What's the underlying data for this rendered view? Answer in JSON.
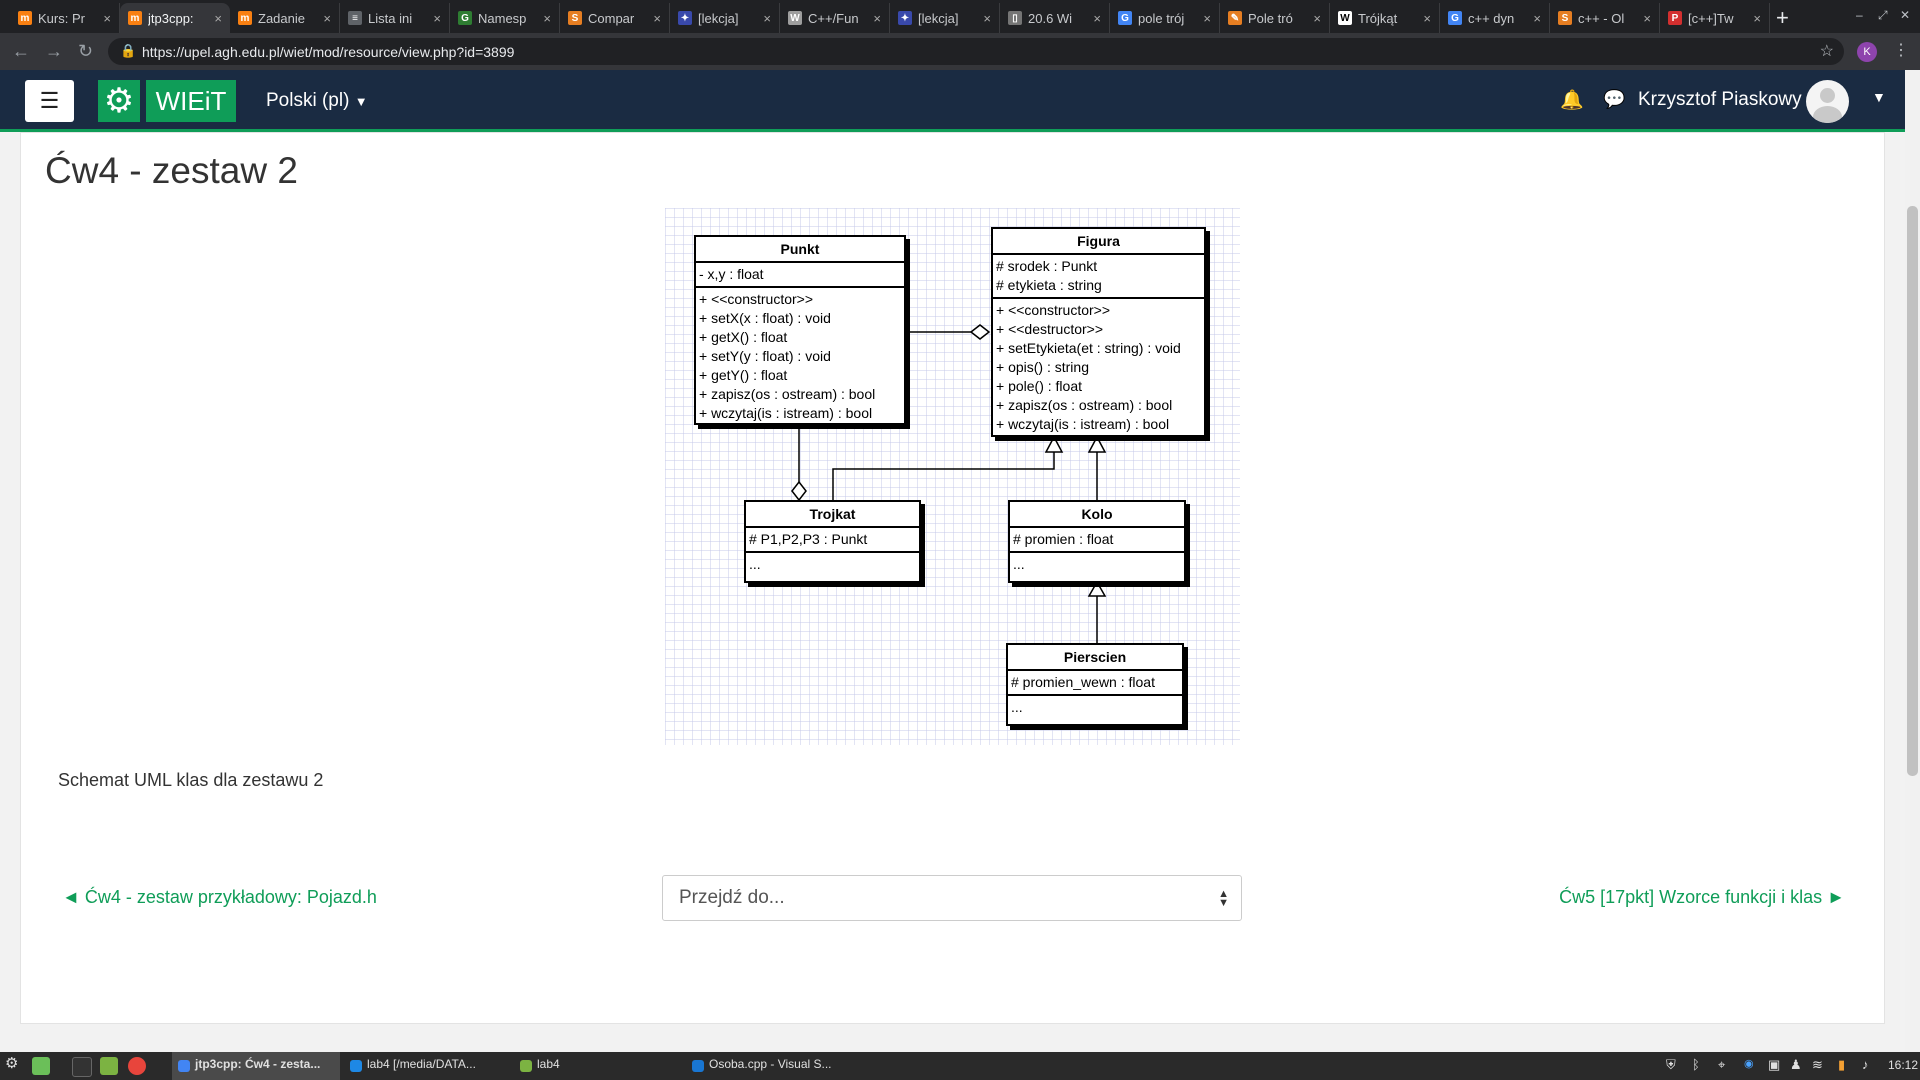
{
  "browser": {
    "tabs": [
      {
        "title": "Kurs: Pr",
        "favicon_color": "#f98012",
        "favicon": "m"
      },
      {
        "title": "jtp3cpp: ",
        "favicon_color": "#f98012",
        "favicon": "m",
        "active": true
      },
      {
        "title": "Zadanie",
        "favicon_color": "#f98012",
        "favicon": "m"
      },
      {
        "title": "Lista ini",
        "favicon_color": "#5f6368",
        "favicon": "≡"
      },
      {
        "title": "Namesp",
        "favicon_color": "#2e7d32",
        "favicon": "G"
      },
      {
        "title": "Compar",
        "favicon_color": "#e67e22",
        "favicon": "S"
      },
      {
        "title": "[lekcja]",
        "favicon_color": "#3949ab",
        "favicon": "✦"
      },
      {
        "title": "C++/Fun",
        "favicon_color": "#9e9e9e",
        "favicon": "W"
      },
      {
        "title": "[lekcja]",
        "favicon_color": "#3949ab",
        "favicon": "✦"
      },
      {
        "title": "20.6 Wi",
        "favicon_color": "#757575",
        "favicon": "▯"
      },
      {
        "title": "pole trój",
        "favicon_color": "#4285f4",
        "favicon": "G"
      },
      {
        "title": "Pole tró",
        "favicon_color": "#e67e22",
        "favicon": "✎"
      },
      {
        "title": "Trójkąt",
        "favicon_color": "#ffffff",
        "favicon": "W"
      },
      {
        "title": "c++ dyn",
        "favicon_color": "#4285f4",
        "favicon": "G"
      },
      {
        "title": "c++ - Ol",
        "favicon_color": "#e67e22",
        "favicon": "S"
      },
      {
        "title": "[c++]Tw",
        "favicon_color": "#d32f2f",
        "favicon": "P"
      }
    ],
    "close_glyph": "×",
    "new_tab": "+",
    "url": "https://upel.agh.edu.pl/wiet/mod/resource/view.php?id=3899",
    "profile_initial": "K"
  },
  "navbar": {
    "logo_text": "WIEiT",
    "language": "Polski (pl)",
    "user_name": "Krzysztof Piaskowy"
  },
  "page": {
    "title": "Ćw4 - zestaw 2",
    "caption": "Schemat UML klas dla zestawu 2",
    "prev_link": "◄ Ćw4 - zestaw przykładowy: Pojazd.h",
    "jump_placeholder": "Przejdź do...",
    "next_link": "Ćw5 [17pkt] Wzorce funkcji i klas ►"
  },
  "uml": {
    "punkt": {
      "name": "Punkt",
      "attrs": [
        "- x,y : float"
      ],
      "methods": [
        "+ <<constructor>>",
        "+ setX(x : float) : void",
        "+ getX() : float",
        "+ setY(y : float) : void",
        "+ getY() : float",
        "+ zapisz(os : ostream) : bool",
        "+ wczytaj(is : istream) : bool"
      ]
    },
    "figura": {
      "name": "Figura",
      "attrs": [
        "# srodek : Punkt",
        "# etykieta : string"
      ],
      "methods": [
        "+ <<constructor>>",
        "+ <<destructor>>",
        "+ setEtykieta(et : string) : void",
        "+ opis() : string",
        "+ pole() : float",
        "+ zapisz(os : ostream) : bool",
        "+ wczytaj(is : istream) : bool"
      ]
    },
    "trojkat": {
      "name": "Trojkat",
      "attrs": [
        "# P1,P2,P3 : Punkt"
      ],
      "methods": [
        "..."
      ]
    },
    "kolo": {
      "name": "Kolo",
      "attrs": [
        "# promien : float"
      ],
      "methods": [
        "..."
      ]
    },
    "pierscien": {
      "name": "Pierscien",
      "attrs": [
        "# promien_wewn : float"
      ],
      "methods": [
        "..."
      ]
    }
  },
  "taskbar": {
    "items": [
      "jtp3cpp: Ćw4 - zesta...",
      "lab4 [/media/DATA...",
      "lab4",
      "Osoba.cpp - Visual S..."
    ],
    "clock": "16:12"
  }
}
